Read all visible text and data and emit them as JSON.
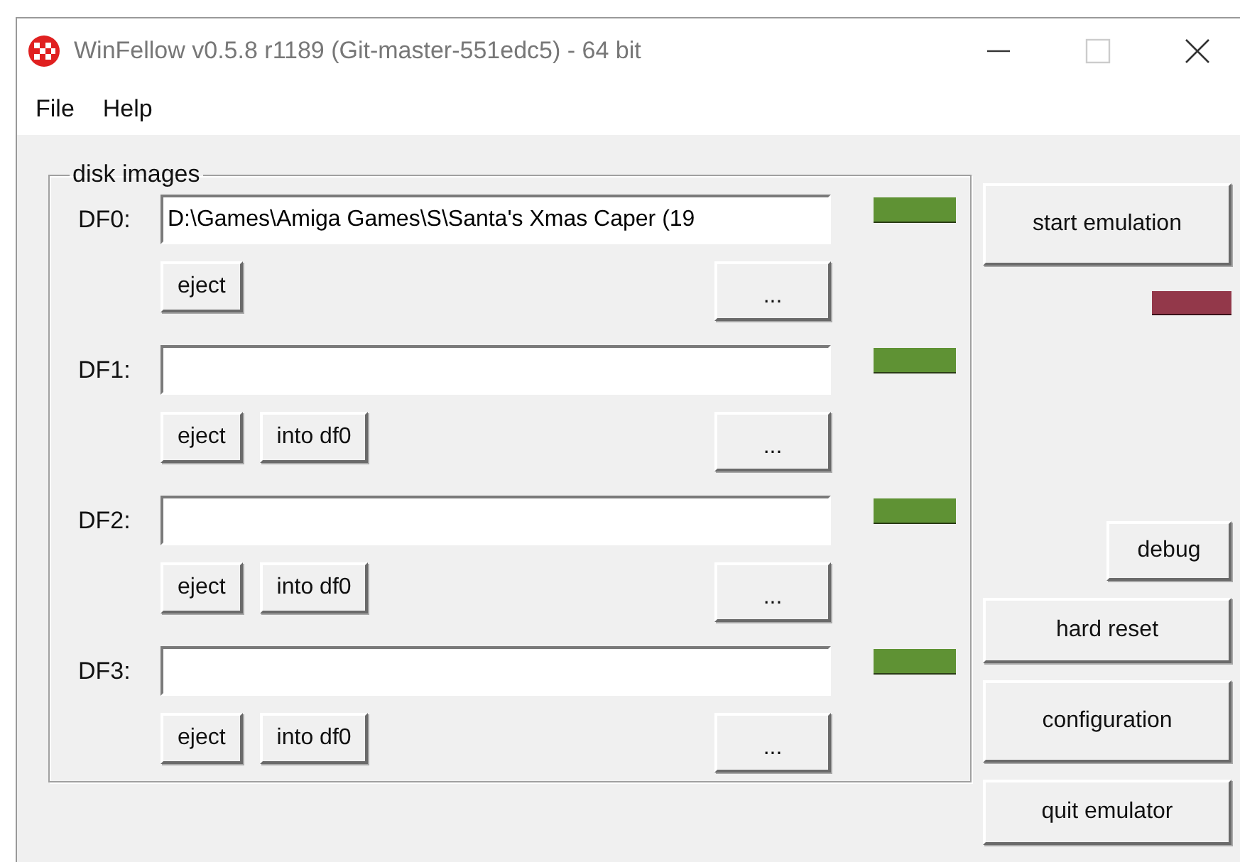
{
  "window": {
    "title": "WinFellow v0.5.8 r1189 (Git-master-551edc5) - 64 bit",
    "maximize_disabled": true
  },
  "menu": [
    "File",
    "Help"
  ],
  "disk_images": {
    "title": "disk images",
    "drives": [
      {
        "label": "DF0:",
        "value": "D:\\Games\\Amiga Games\\S\\Santa's Xmas Caper (19",
        "led": {
          "color": "#5f9234"
        },
        "buttons": [
          "eject"
        ],
        "browse": "..."
      },
      {
        "label": "DF1:",
        "led": {
          "color": "#5f9234"
        },
        "buttons": [
          "eject",
          "into df0"
        ],
        "browse": "..."
      },
      {
        "label": "DF2:",
        "led": {
          "color": "#5f9234"
        },
        "buttons": [
          "eject",
          "into df0"
        ],
        "browse": "..."
      },
      {
        "label": "DF3:",
        "led": {
          "color": "#5f9234"
        },
        "buttons": [
          "eject",
          "into df0"
        ],
        "browse": "..."
      }
    ]
  },
  "power_led": {
    "color": "#93384a"
  },
  "actions": [
    {
      "label": "start emulation",
      "kind": "big"
    },
    {
      "label": "debug",
      "kind": "small"
    },
    {
      "label": "hard reset",
      "kind": "normal"
    },
    {
      "label": "configuration",
      "kind": "big"
    },
    {
      "label": "quit emulator",
      "kind": "normal"
    }
  ]
}
